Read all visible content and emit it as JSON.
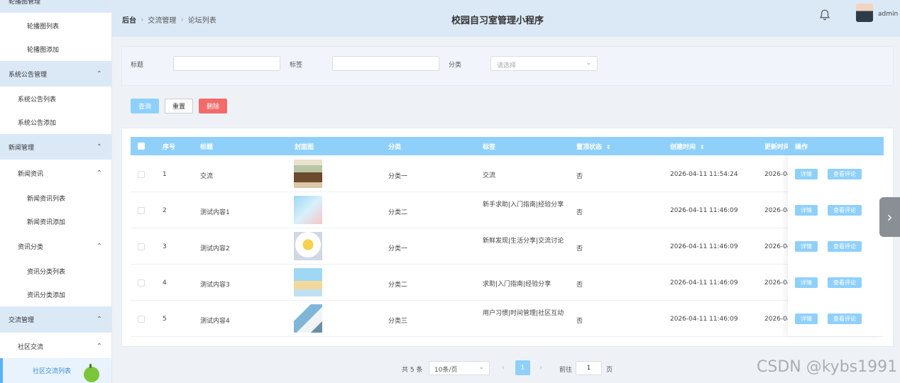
{
  "sidebar": {
    "items": [
      {
        "label": "轮播图管理",
        "level": 0,
        "group": true,
        "chevron": "chevron-up-icon"
      },
      {
        "label": "轮播图列表",
        "level": 2
      },
      {
        "label": "轮播图添加",
        "level": 2
      },
      {
        "label": "系统公告管理",
        "level": 0,
        "group": true,
        "chevron": "chevron-up-icon"
      },
      {
        "label": "系统公告列表",
        "level": 1
      },
      {
        "label": "系统公告添加",
        "level": 1
      },
      {
        "label": "新闻管理",
        "level": 0,
        "group": true,
        "chevron": "chevron-up-icon"
      },
      {
        "label": "新闻资讯",
        "level": 1,
        "chevron": "chevron-up-icon"
      },
      {
        "label": "新闻资讯列表",
        "level": 2
      },
      {
        "label": "新闻资讯添加",
        "level": 2
      },
      {
        "label": "资讯分类",
        "level": 1,
        "chevron": "chevron-up-icon"
      },
      {
        "label": "资讯分类列表",
        "level": 2
      },
      {
        "label": "资讯分类添加",
        "level": 2
      },
      {
        "label": "交流管理",
        "level": 0,
        "group": true,
        "chevron": "chevron-up-icon"
      },
      {
        "label": "社区交流",
        "level": 1,
        "chevron": "chevron-up-icon"
      },
      {
        "label": "社区交流列表",
        "level": 2,
        "active": true
      }
    ]
  },
  "header": {
    "breadcrumb": [
      "后台",
      "交流管理",
      "论坛列表"
    ],
    "title": "校园自习室管理小程序",
    "user": "admin"
  },
  "search": {
    "title_label": "标题",
    "tag_label": "标签",
    "category_label": "分类",
    "category_placeholder": "请选择"
  },
  "actions": {
    "search": "查询",
    "reset": "重置",
    "delete": "删除"
  },
  "table": {
    "columns": [
      "序号",
      "标题",
      "封面图",
      "分类",
      "标签",
      "置顶状态",
      "创建时间",
      "更新时间",
      "操作"
    ],
    "rows": [
      {
        "no": "1",
        "title": "交流",
        "category": "分类一",
        "tags": "交流",
        "pinned": "否",
        "created": "2026-04-11 11:54:24",
        "updated": "2026-04"
      },
      {
        "no": "2",
        "title": "测试内容1",
        "category": "分类二",
        "tags": "新手求助|入门指南|经验分享",
        "pinned": "否",
        "created": "2026-04-11 11:46:09",
        "updated": "2026-04"
      },
      {
        "no": "3",
        "title": "测试内容2",
        "category": "分类一",
        "tags": "新鲜发现|生活分享|交流讨论",
        "pinned": "否",
        "created": "2026-04-11 11:46:09",
        "updated": "2026-04"
      },
      {
        "no": "4",
        "title": "测试内容3",
        "category": "分类二",
        "tags": "求助|入门指南|经验分享",
        "pinned": "否",
        "created": "2026-04-11 11:46:09",
        "updated": "2026-04"
      },
      {
        "no": "5",
        "title": "测试内容4",
        "category": "分类三",
        "tags": "用户习惯|时间管理|社区互动",
        "pinned": "否",
        "created": "2026-04-11 11:46:09",
        "updated": "2026-04"
      }
    ],
    "row_actions": {
      "detail": "详情",
      "comments": "查看评论"
    }
  },
  "pagination": {
    "total": "共 5 条",
    "page_size": "10条/页",
    "current_page": "1",
    "goto_label": "前往",
    "goto_value": "1",
    "page_unit": "页"
  },
  "watermark": "CSDN @kybs1991",
  "colors": {
    "accent": "#8fd0fb",
    "danger": "#f26b6b",
    "menu_group_bg": "#dbe9f7"
  }
}
